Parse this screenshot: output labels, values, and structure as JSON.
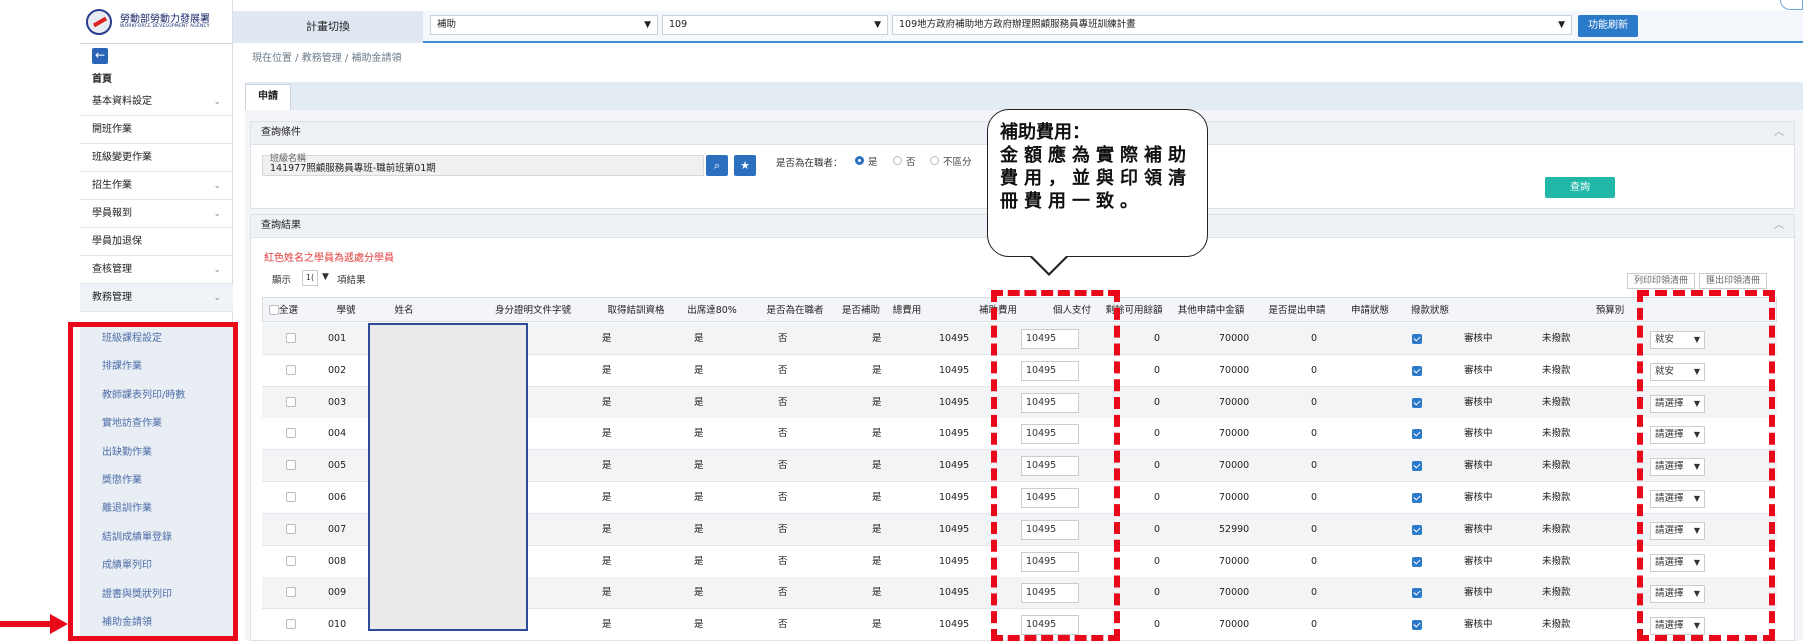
{
  "logo": {
    "title": "勞動部勞動力發展署",
    "subtitle": "WORKFORCE DEVELOPMENT AGENCY"
  },
  "sidebar": {
    "back_icon": "←",
    "home": "首頁",
    "items": [
      {
        "label": "基本資料設定",
        "chevron": "⌄"
      },
      {
        "label": "開班作業",
        "chevron": ""
      },
      {
        "label": "班級變更作業",
        "chevron": ""
      },
      {
        "label": "招生作業",
        "chevron": "⌄"
      },
      {
        "label": "學員報到",
        "chevron": "⌄"
      },
      {
        "label": "學員加退保",
        "chevron": ""
      },
      {
        "label": "查核管理",
        "chevron": "⌄"
      },
      {
        "label": "教務管理",
        "chevron": "⌄"
      }
    ],
    "subitems": [
      "班級課程設定",
      "排課作業",
      "教師課表列印/時數",
      "實地訪查作業",
      "出缺勤作業",
      "獎懲作業",
      "離退訓作業",
      "結訓成績單登錄",
      "成績單列印",
      "證書與獎狀列印",
      "補助金請領"
    ]
  },
  "topbar": {
    "plan_switch": "計畫切換",
    "select1": "補助",
    "select2": "109",
    "select3": "109地方政府補助地方政府辦理照顧服務員專班訓練計畫",
    "refresh": "功能刷新"
  },
  "breadcrumb": "現在位置 / 教務管理 / 補助金請領",
  "tab": "申請",
  "query": {
    "header": "查詢條件",
    "class_label": "班級名稱",
    "class_value": "141977照顧服務員專班-職前班第01期",
    "employed_label": "是否為在職者：",
    "radios": [
      {
        "label": "是"
      },
      {
        "label": "否"
      },
      {
        "label": "不區分"
      }
    ],
    "button": "查詢"
  },
  "results": {
    "header": "查詢結果",
    "note": "紅色姓名之學員為遞處分學員",
    "show_label": "顯示",
    "show_value": "1(",
    "show_suffix": "項結果",
    "btn_print": "列印印領清冊",
    "btn_export": "匯出印領清冊",
    "columns": [
      "全選",
      "學號",
      "姓名",
      "身分證明文件字號",
      "取得結訓資格",
      "出席達80%",
      "是否為在職者",
      "是否補助",
      "總費用",
      "補助費用",
      "個人支付",
      "剩餘可用餘額",
      "其他申請中金額",
      "是否提出申請",
      "申請狀態",
      "撥款狀態",
      "預算別"
    ],
    "rows": [
      {
        "id": "001",
        "cert": "是",
        "att": "是",
        "emp": "否",
        "sub": "是",
        "total": "10495",
        "fee": "10495",
        "pay": "0",
        "remain": "70000",
        "other": "0",
        "status": "審核中",
        "paid": "未撥款",
        "budget": "就安"
      },
      {
        "id": "002",
        "cert": "是",
        "att": "是",
        "emp": "否",
        "sub": "是",
        "total": "10495",
        "fee": "10495",
        "pay": "0",
        "remain": "70000",
        "other": "0",
        "status": "審核中",
        "paid": "未撥款",
        "budget": "就安"
      },
      {
        "id": "003",
        "cert": "是",
        "att": "是",
        "emp": "否",
        "sub": "是",
        "total": "10495",
        "fee": "10495",
        "pay": "0",
        "remain": "70000",
        "other": "0",
        "status": "審核中",
        "paid": "未撥款",
        "budget": "請選擇"
      },
      {
        "id": "004",
        "cert": "是",
        "att": "是",
        "emp": "否",
        "sub": "是",
        "total": "10495",
        "fee": "10495",
        "pay": "0",
        "remain": "70000",
        "other": "0",
        "status": "審核中",
        "paid": "未撥款",
        "budget": "請選擇"
      },
      {
        "id": "005",
        "cert": "是",
        "att": "是",
        "emp": "否",
        "sub": "是",
        "total": "10495",
        "fee": "10495",
        "pay": "0",
        "remain": "70000",
        "other": "0",
        "status": "審核中",
        "paid": "未撥款",
        "budget": "請選擇"
      },
      {
        "id": "006",
        "cert": "是",
        "att": "是",
        "emp": "否",
        "sub": "是",
        "total": "10495",
        "fee": "10495",
        "pay": "0",
        "remain": "70000",
        "other": "0",
        "status": "審核中",
        "paid": "未撥款",
        "budget": "請選擇"
      },
      {
        "id": "007",
        "cert": "是",
        "att": "是",
        "emp": "否",
        "sub": "是",
        "total": "10495",
        "fee": "10495",
        "pay": "0",
        "remain": "52990",
        "other": "0",
        "status": "審核中",
        "paid": "未撥款",
        "budget": "請選擇"
      },
      {
        "id": "008",
        "cert": "是",
        "att": "是",
        "emp": "否",
        "sub": "是",
        "total": "10495",
        "fee": "10495",
        "pay": "0",
        "remain": "70000",
        "other": "0",
        "status": "審核中",
        "paid": "未撥款",
        "budget": "請選擇"
      },
      {
        "id": "009",
        "cert": "是",
        "att": "是",
        "emp": "否",
        "sub": "是",
        "total": "10495",
        "fee": "10495",
        "pay": "0",
        "remain": "70000",
        "other": "0",
        "status": "審核中",
        "paid": "未撥款",
        "budget": "請選擇"
      },
      {
        "id": "010",
        "cert": "是",
        "att": "是",
        "emp": "否",
        "sub": "是",
        "total": "10495",
        "fee": "10495",
        "pay": "0",
        "remain": "70000",
        "other": "0",
        "status": "審核中",
        "paid": "未撥款",
        "budget": "請選擇"
      }
    ]
  },
  "callout": {
    "title": "補助費用：",
    "body": "金額應為實際補助費用，並與印領清冊費用一致。"
  },
  "icons": {
    "search": "search-icon",
    "star": "star-icon"
  },
  "colors": {
    "annotation_red": "#e8091a",
    "primary_blue": "#2b79c9",
    "query_teal": "#20b7a8"
  }
}
